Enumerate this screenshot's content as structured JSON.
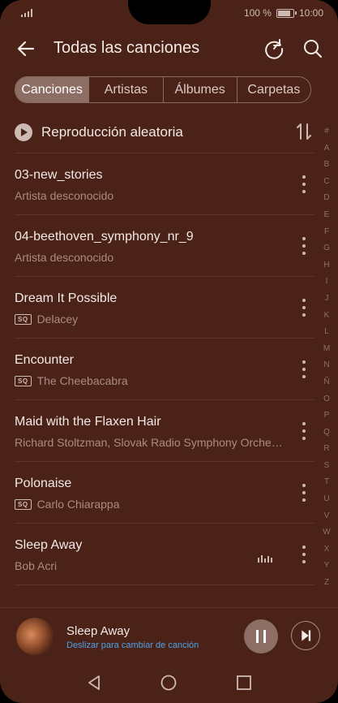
{
  "status": {
    "battery": "100 %",
    "time": "10:00"
  },
  "header": {
    "title": "Todas las canciones"
  },
  "tabs": [
    {
      "label": "Canciones",
      "active": true
    },
    {
      "label": "Artistas",
      "active": false
    },
    {
      "label": "Álbumes",
      "active": false
    },
    {
      "label": "Carpetas",
      "active": false
    }
  ],
  "shuffle": {
    "label": "Reproducción aleatoria"
  },
  "songs": [
    {
      "title": "03-new_stories",
      "artist": "Artista desconocido",
      "sq": false,
      "playing": false
    },
    {
      "title": "04-beethoven_symphony_nr_9",
      "artist": "Artista desconocido",
      "sq": false,
      "playing": false
    },
    {
      "title": "Dream It Possible",
      "artist": "Delacey",
      "sq": true,
      "playing": false
    },
    {
      "title": "Encounter",
      "artist": "The Cheebacabra",
      "sq": true,
      "playing": false
    },
    {
      "title": "Maid with the Flaxen Hair",
      "artist": "Richard Stoltzman, Slovak Radio Symphony Orche…",
      "sq": false,
      "playing": false
    },
    {
      "title": "Polonaise",
      "artist": "Carlo Chiarappa",
      "sq": true,
      "playing": false
    },
    {
      "title": "Sleep Away",
      "artist": "Bob Acri",
      "sq": false,
      "playing": true
    }
  ],
  "sq_badge": "SQ",
  "index_letters": [
    "#",
    "A",
    "B",
    "C",
    "D",
    "E",
    "F",
    "G",
    "H",
    "I",
    "J",
    "K",
    "L",
    "M",
    "N",
    "Ñ",
    "O",
    "P",
    "Q",
    "R",
    "S",
    "T",
    "U",
    "V",
    "W",
    "X",
    "Y",
    "Z"
  ],
  "now_playing": {
    "title": "Sleep Away",
    "hint": "Deslizar para cambiar de canción"
  },
  "colors": {
    "background": "#4a2217",
    "accent_link": "#4ea2e8"
  }
}
